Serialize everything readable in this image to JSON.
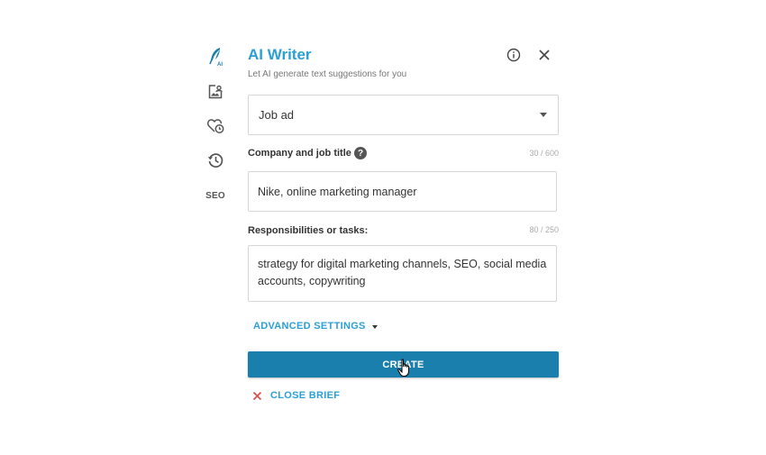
{
  "sidebar": {
    "items": [
      {
        "icon": "ai-quill-icon",
        "label": "AI",
        "active": true
      },
      {
        "icon": "image-user-icon"
      },
      {
        "icon": "heart-clock-icon"
      },
      {
        "icon": "history-icon"
      },
      {
        "icon": "seo-icon",
        "label": "SEO"
      }
    ]
  },
  "header": {
    "title": "AI Writer",
    "subtitle": "Let AI generate text suggestions for you",
    "info_icon": "info-icon",
    "close_icon": "close-icon"
  },
  "template_select": {
    "value": "Job ad"
  },
  "fields": {
    "company": {
      "label": "Company and job title",
      "counter": "30 / 600",
      "value": "Nike, online marketing manager"
    },
    "responsibilities": {
      "label": "Responsibilities or tasks:",
      "counter": "80 / 250",
      "value": "strategy for digital marketing channels, SEO, social media accounts, copywriting"
    }
  },
  "advanced_settings": {
    "label": "ADVANCED SETTINGS"
  },
  "create_button": {
    "label": "CREATE"
  },
  "close_brief": {
    "label": "CLOSE BRIEF"
  },
  "colors": {
    "accent": "#2a9fd6",
    "primary_button": "#1a7fad",
    "close_x": "#d9534f"
  }
}
